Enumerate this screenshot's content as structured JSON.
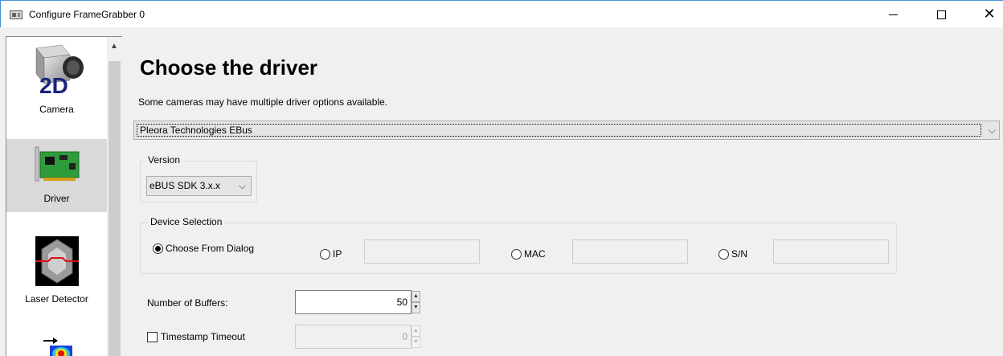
{
  "window": {
    "title": "Configure FrameGrabber 0"
  },
  "sidebar": {
    "items": [
      {
        "label": "Camera",
        "icon": "camera-2d-icon"
      },
      {
        "label": "Driver",
        "icon": "pci-card-icon",
        "selected": true
      },
      {
        "label": "Laser Detector",
        "icon": "laser-detector-icon"
      },
      {
        "label": "",
        "icon": "heatmap-arrow-icon"
      }
    ]
  },
  "main": {
    "heading": "Choose the driver",
    "subtext": "Some cameras may have multiple driver options available.",
    "driver_select": "Pleora Technologies EBus",
    "version": {
      "legend": "Version",
      "selected": "eBUS SDK 3.x.x"
    },
    "device_selection": {
      "legend": "Device Selection",
      "options": [
        {
          "label": "Choose From Dialog",
          "checked": true
        },
        {
          "label": "IP",
          "checked": false
        },
        {
          "label": "MAC",
          "checked": false
        },
        {
          "label": "S/N",
          "checked": false
        }
      ]
    },
    "buffers": {
      "label": "Number of Buffers:",
      "value": "50"
    },
    "timestamp": {
      "label": "Timestamp Timeout",
      "checked": false,
      "value": "0"
    }
  }
}
